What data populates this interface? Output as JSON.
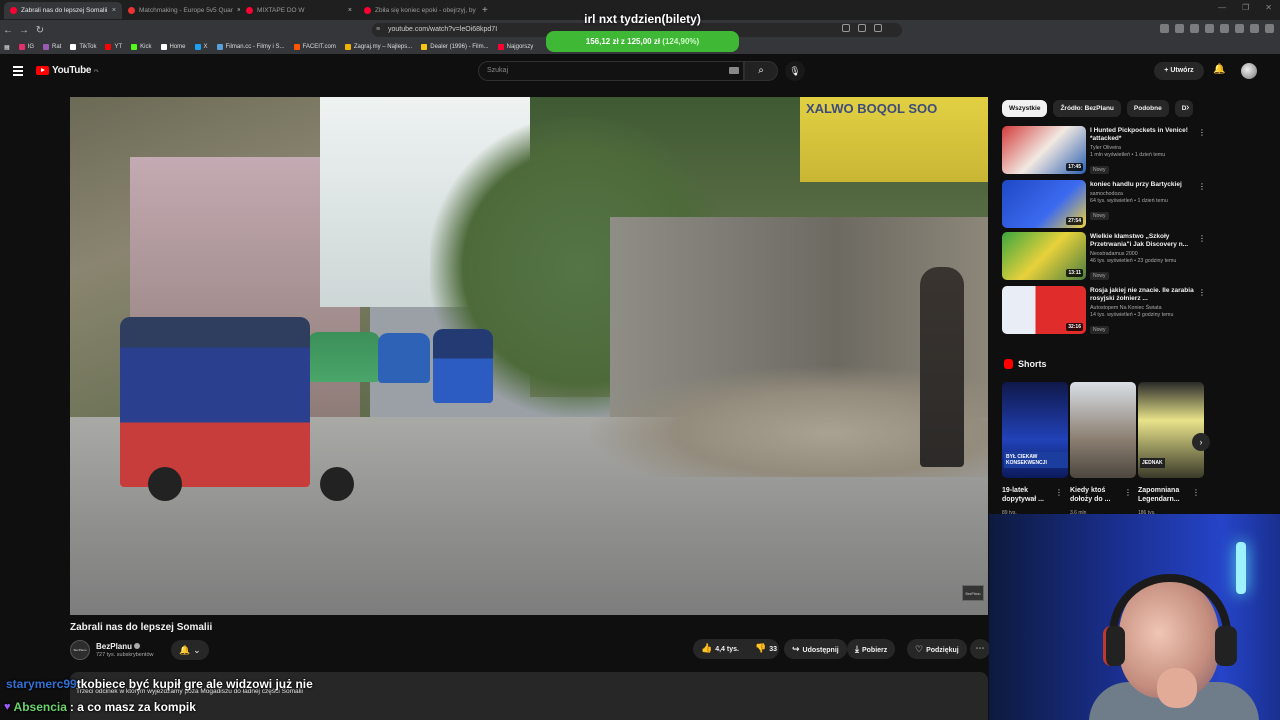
{
  "browser": {
    "tabs": [
      {
        "label": "Zabrali nas do lepszej Somalii",
        "active": true,
        "color": "#ff0033"
      },
      {
        "label": "Matchmaking - Europe 5v5 Quar",
        "active": false,
        "color": "#e33"
      },
      {
        "label": "MIXTAPE DO W",
        "active": false,
        "color": "#ff0033"
      },
      {
        "label": "Zbiła się koniec epoki - obejrzyj, by",
        "active": false,
        "color": "#ff0033"
      }
    ],
    "new_tab": "+",
    "url": "youtube.com/watch?v=leOi68kpd7I",
    "bookmarks": [
      {
        "label": "IG",
        "color": "#e1306c"
      },
      {
        "label": "Rat",
        "color": "#9b59b6"
      },
      {
        "label": "TikTok",
        "color": "#ffffff"
      },
      {
        "label": "YT",
        "color": "#ff0000"
      },
      {
        "label": "Kick",
        "color": "#53fc18"
      },
      {
        "label": "Home",
        "color": "#ffffff"
      },
      {
        "label": "X",
        "color": "#1da1f2"
      },
      {
        "label": "Filman.cc - Filmy i S...",
        "color": "#5aa0d8"
      },
      {
        "label": "FACEIT.com",
        "color": "#ff5500"
      },
      {
        "label": "Zagraj.my – Najleps...",
        "color": "#f0b400"
      },
      {
        "label": "Dealer (1996) - Film...",
        "color": "#f5c518"
      },
      {
        "label": "Najgorszy",
        "color": "#ff0033"
      }
    ]
  },
  "overlay": {
    "title": "irl nxt tydzien(bilety)",
    "goal_text": "156,12 zł  z  125,00 zł",
    "goal_pct": "(124,90%)",
    "goal_color": "#3fb836"
  },
  "yt_header": {
    "logo": "YouTube",
    "region": "PL",
    "search_placeholder": "Szukaj",
    "create_label": "Utwórz"
  },
  "video": {
    "title": "Zabrali nas do lepszej Somalii",
    "sign_text": "XALWO BOQOL SOO",
    "watermark": "BezPlanu"
  },
  "channel": {
    "avatar_text": "BezPlanu",
    "name": "BezPlanu",
    "subs": "727 tys. subskrybentów"
  },
  "actions": {
    "likes": "4,4 tys.",
    "dislikes": "33",
    "share": "Udostępnij",
    "download": "Pobierz",
    "thanks": "Podziękuj"
  },
  "description": {
    "line": "Trzeci odcinek w którym wyjeżdżamy poza Mogadiszu do ładnej części Somalii"
  },
  "chat": [
    {
      "user": "starymerc99",
      "message": "tkobiece być kupił gre ale widzowi już nie",
      "color": "#2f72d6"
    },
    {
      "user": "Absencia",
      "message": ": a co masz za kompik",
      "color": "#6bd16b"
    }
  ],
  "sidebar": {
    "chips": [
      {
        "label": "Wszystkie",
        "active": true
      },
      {
        "label": "Źródło: BezPlanu",
        "active": false
      },
      {
        "label": "Podobne",
        "active": false
      },
      {
        "label": "D",
        "active": false
      }
    ],
    "recommended": [
      {
        "title": "I Hunted Pickpockets in Venice! *attacked*",
        "channel": "Tyler Oliveira",
        "views": "1 mln wyświetleń • 1 dzień temu",
        "badge": "Nowy",
        "duration": "17:45",
        "thumb": "linear-gradient(135deg,#d23b3b,#f2e9e2 50%,#2a5fb0)"
      },
      {
        "title": "koniec handlu przy Bartyckiej",
        "channel": "samochodoza",
        "views": "64 tys. wyświetleń • 1 dzień temu",
        "badge": "Nowy",
        "duration": "27:54",
        "thumb": "linear-gradient(135deg,#1f49c4,#3c6af0 60%,#f1d23a)"
      },
      {
        "title": "Wielkie kłamstwo „Szkoły Przetrwania\"i Jak Discovery n...",
        "channel": "Neostradamus 2000",
        "views": "46 tys. wyświetleń • 23 godziny temu",
        "badge": "Nowy",
        "duration": "13:11",
        "thumb": "linear-gradient(135deg,#3aa63f,#e7d13b 50%,#4a7c3f)"
      },
      {
        "title": "Rosja jakiej nie znacie. Ile zarabia rosyjski żołnierz ...",
        "channel": "Autostopem Na Koniec Świata",
        "views": "14 tys. wyświetleń • 3 godziny temu",
        "badge": "Nowy",
        "duration": "32:16",
        "thumb": "linear-gradient(90deg,#e9eef6 0 40%,#e12c2c 40%)"
      }
    ],
    "shorts_title": "Shorts",
    "shorts": [
      {
        "title": "19-latek dopytywał ...",
        "views": "89 tys.",
        "caption": "BYŁ CIEKAW KONSEKWENCJI",
        "thumb": "linear-gradient(#10184a,#2142b8 60%,#0b1a5c)"
      },
      {
        "title": "Kiedy ktoś dołoży do ...",
        "views": "3,6 mln",
        "caption": "",
        "thumb": "linear-gradient(#d9dfe6,#8a7e70 60%,#4d4740)"
      },
      {
        "title": "Zapomniana Legendarn...",
        "views": "186 tys.",
        "caption": "JEDNAK",
        "thumb": "linear-gradient(#2a2a2a,#e8e38a 40%,#3a3a2a)"
      }
    ]
  }
}
